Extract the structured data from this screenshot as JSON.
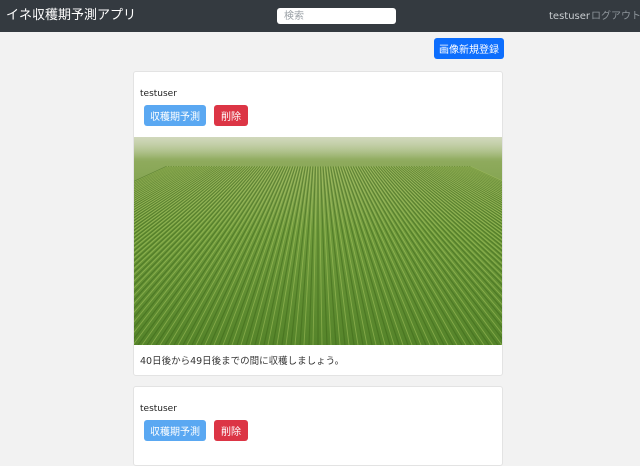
{
  "navbar": {
    "brand": "イネ収穫期予測アプリ",
    "search_placeholder": "検索",
    "user": "testuser",
    "logout": "ログアウト"
  },
  "actions": {
    "new_image_label": "画像新規登録"
  },
  "posts": [
    {
      "user": "testuser",
      "predict_label": "収穫期予測",
      "delete_label": "削除",
      "image": "rice-paddy-field-photo",
      "caption": "40日後から49日後までの間に収穫しましょう。"
    },
    {
      "user": "testuser",
      "predict_label": "収穫期予測",
      "delete_label": "削除"
    }
  ],
  "colors": {
    "navbar": "#343a40",
    "primary": "#0d6efd",
    "predict": "#5aa8f2",
    "danger": "#dc3545",
    "background": "#f2f2f2"
  }
}
